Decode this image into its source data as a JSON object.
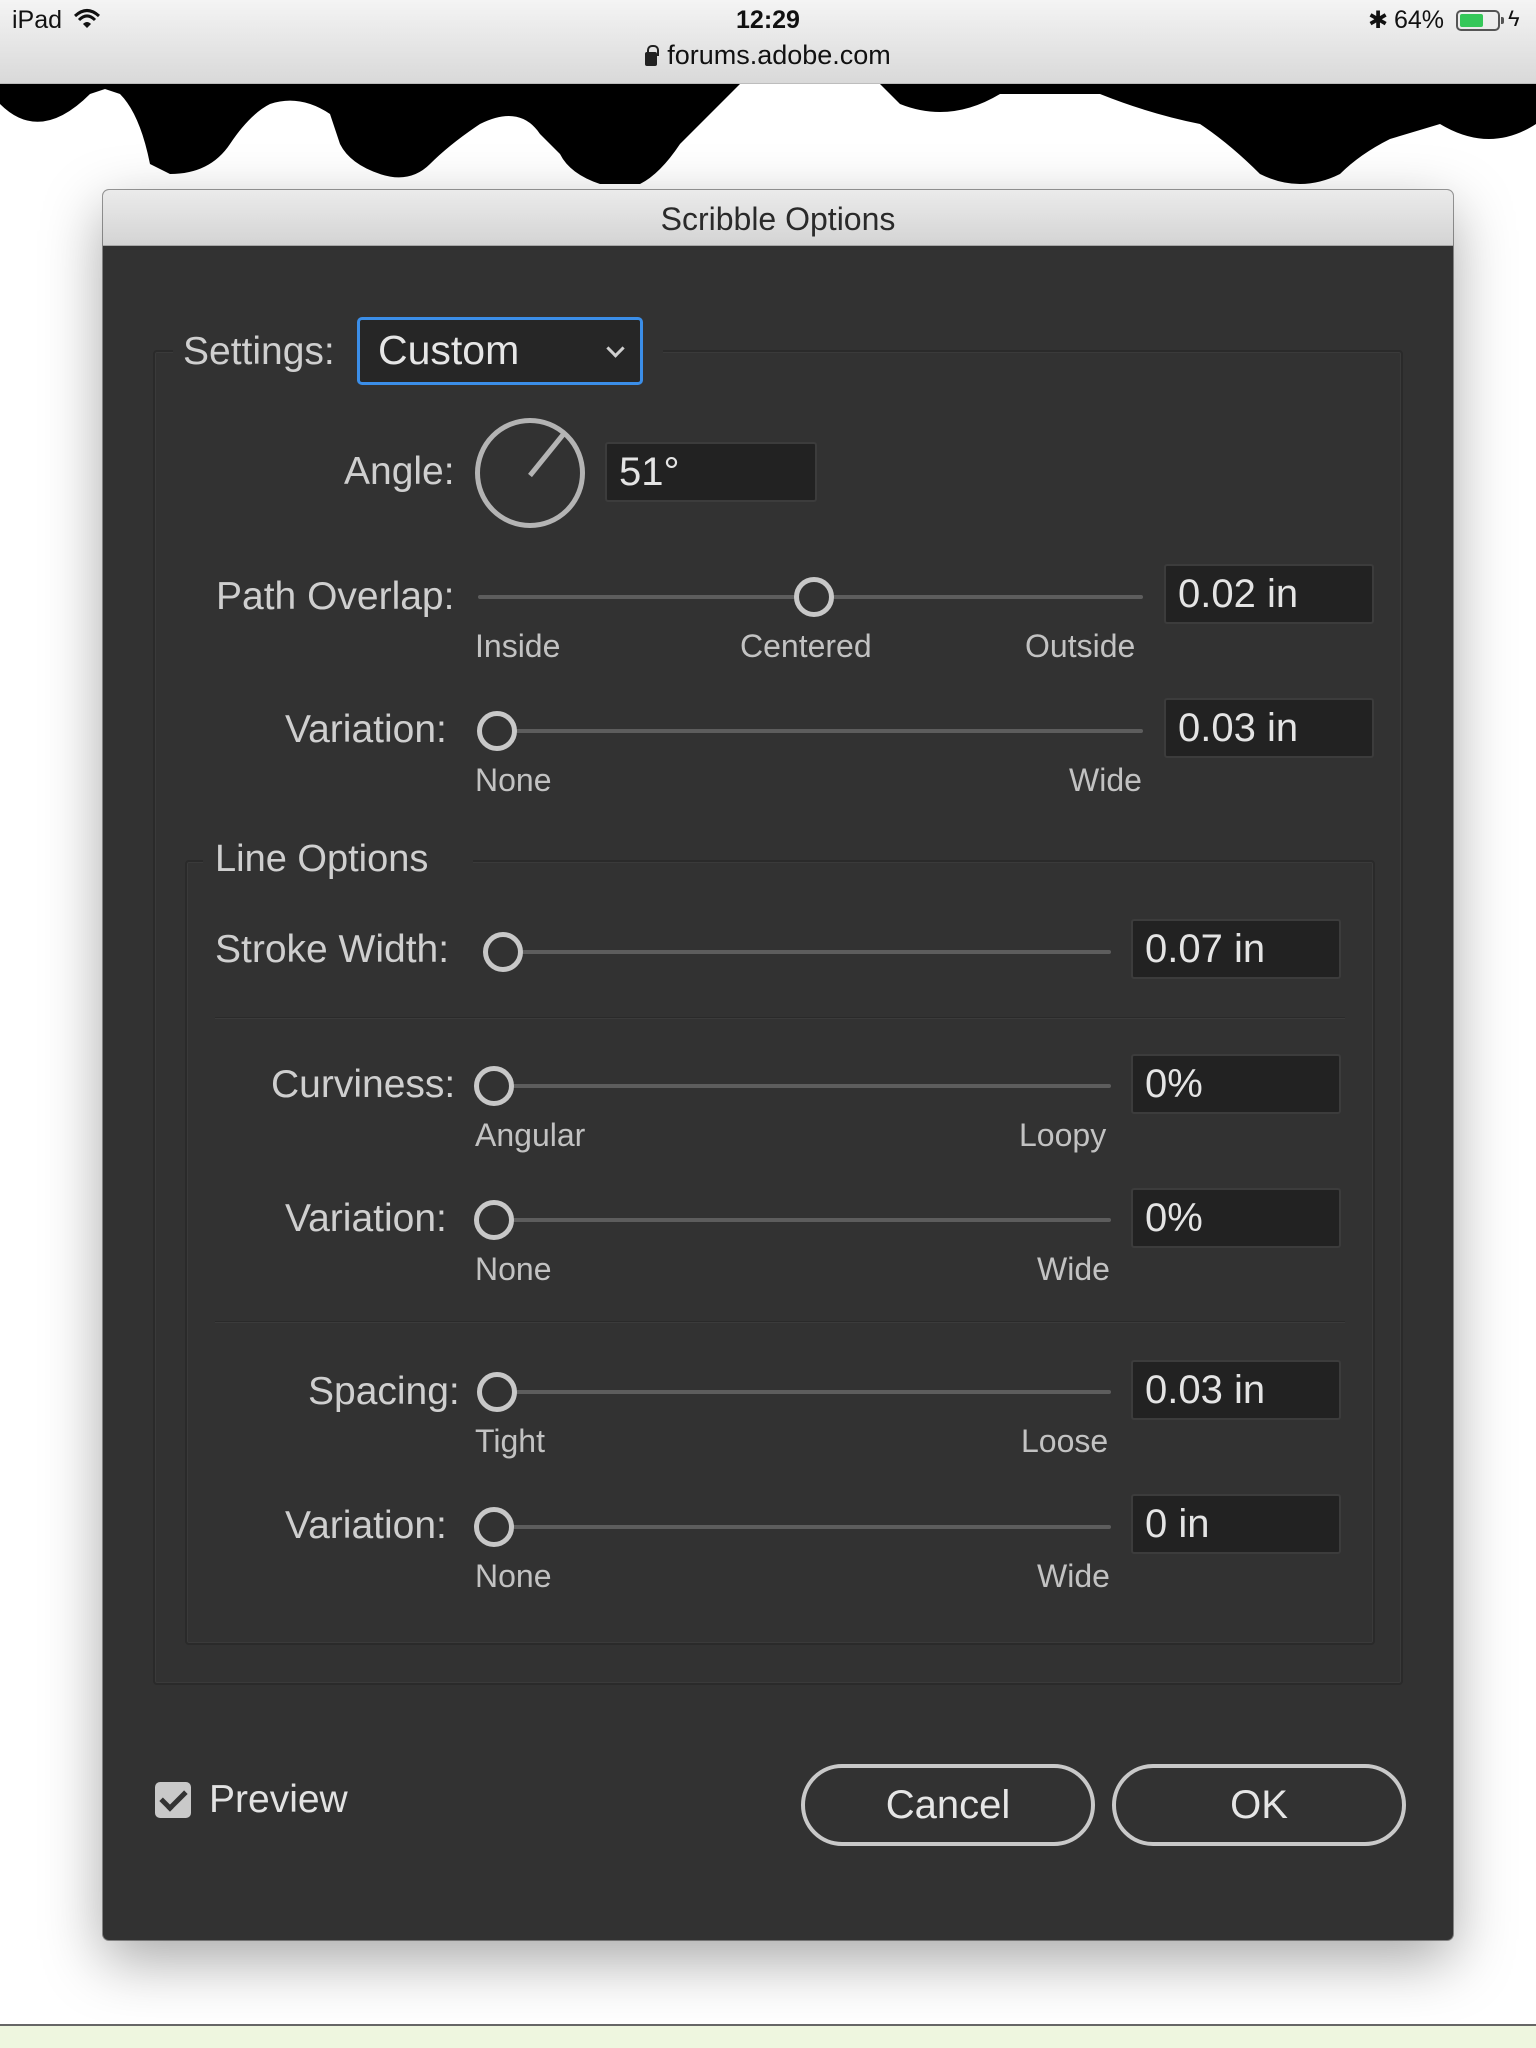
{
  "status_bar": {
    "device": "iPad",
    "time": "12:29",
    "url": "forums.adobe.com",
    "battery": "64%",
    "battery_level": 0.64
  },
  "dialog": {
    "title": "Scribble Options",
    "settings": {
      "label": "Settings:",
      "value": "Custom"
    },
    "angle": {
      "label": "Angle:",
      "value": "51°",
      "degrees": 51
    },
    "path_overlap": {
      "label": "Path Overlap:",
      "value": "0.02 in",
      "min_label": "Inside",
      "mid_label": "Centered",
      "max_label": "Outside",
      "position": 0.5
    },
    "path_variation": {
      "label": "Variation:",
      "value": "0.03 in",
      "min_label": "None",
      "max_label": "Wide",
      "position": 0.0
    },
    "line_options": {
      "title": "Line Options",
      "stroke_width": {
        "label": "Stroke Width:",
        "value": "0.07 in",
        "position": 0.0
      },
      "curviness": {
        "label": "Curviness:",
        "value": "0%",
        "min_label": "Angular",
        "max_label": "Loopy",
        "position": 0.0
      },
      "curviness_variation": {
        "label": "Variation:",
        "value": "0%",
        "min_label": "None",
        "max_label": "Wide",
        "position": 0.0
      },
      "spacing": {
        "label": "Spacing:",
        "value": "0.03 in",
        "min_label": "Tight",
        "max_label": "Loose",
        "position": 0.0
      },
      "spacing_variation": {
        "label": "Variation:",
        "value": "0 in",
        "min_label": "None",
        "max_label": "Wide",
        "position": 0.0
      }
    },
    "preview": {
      "label": "Preview",
      "checked": true
    },
    "buttons": {
      "cancel": "Cancel",
      "ok": "OK"
    }
  }
}
